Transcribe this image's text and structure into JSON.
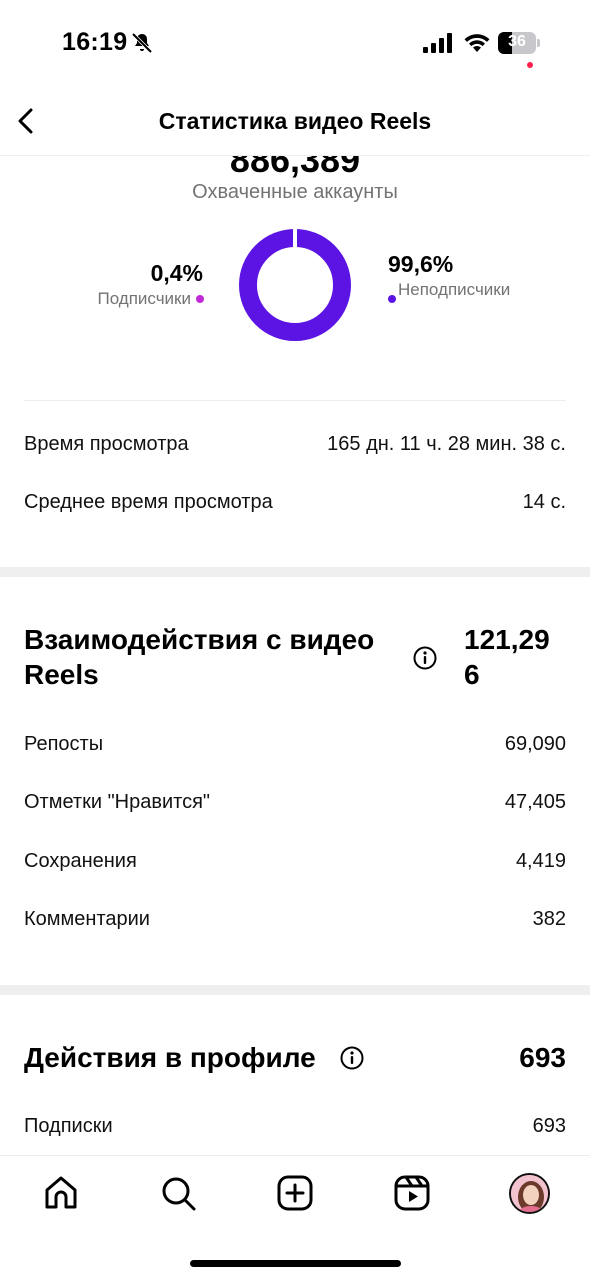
{
  "status_bar": {
    "time": "16:19",
    "battery": "36",
    "icons": [
      "bell-off-icon",
      "signal-icon",
      "wifi-icon",
      "battery-icon"
    ]
  },
  "header": {
    "title": "Статистика видео Reels",
    "back_icon": "chevron-left-icon"
  },
  "reach": {
    "value": "886,389",
    "label": "Охваченные аккаунты",
    "followers": {
      "pct": "0,4%",
      "label": "Подписчики",
      "share": 0.004,
      "color": "#c02ad6"
    },
    "nonfollowers": {
      "pct": "99,6%",
      "label": "Неподписчики",
      "share": 0.996,
      "color": "#5b14e3"
    }
  },
  "watch": {
    "total_label": "Время просмотра",
    "total_value": "165 дн. 11 ч. 28 мин. 38 с.",
    "avg_label": "Среднее время просмотра",
    "avg_value": "14 с."
  },
  "interactions": {
    "title_line1": "Взаимодействия с видео",
    "title_line2": "Reels",
    "total_line1": "121,29",
    "total_line2": "6",
    "rows": [
      {
        "label": "Репосты",
        "value": "69,090"
      },
      {
        "label": "Отметки \"Нравится\"",
        "value": "47,405"
      },
      {
        "label": "Сохранения",
        "value": "4,419"
      },
      {
        "label": "Комментарии",
        "value": "382"
      }
    ]
  },
  "profile_actions": {
    "title": "Действия в профиле",
    "total": "693",
    "rows": [
      {
        "label": "Подписки",
        "value": "693"
      }
    ]
  },
  "bottom_nav": {
    "items": [
      "home-icon",
      "search-icon",
      "create-icon",
      "reels-icon",
      "profile-avatar"
    ]
  },
  "colors": {
    "accent_purple": "#5b14e3",
    "accent_magenta": "#c02ad6",
    "muted_text": "#737373"
  }
}
